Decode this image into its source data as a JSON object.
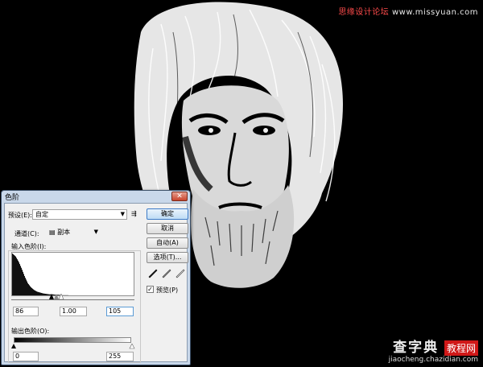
{
  "watermark_top": {
    "cn": "思缘设计论坛",
    "url": "www.missyuan.com"
  },
  "watermark_bottom": {
    "big": "查字典",
    "boxed": "教程网",
    "url": "jiaocheng.chazidian.com"
  },
  "dialog": {
    "title": "色阶",
    "close_symbol": "✕",
    "preset_label": "预设(E):",
    "preset_value": "自定",
    "preset_options_icon": "⇶",
    "channel_label": "通道(C):",
    "channel_value": "副本",
    "input_levels_label": "输入色阶(I):",
    "input_black": "86",
    "input_gamma": "1.00",
    "input_white": "105",
    "output_levels_label": "输出色阶(O):",
    "output_black": "0",
    "output_white": "255",
    "buttons": {
      "ok": "确定",
      "cancel": "取消",
      "auto": "自动(A)",
      "options": "选项(T)..."
    },
    "preview_label": "预览(P)",
    "preview_checked": true,
    "checkmark": "✓",
    "eyedroppers": [
      "black-eyedropper-icon",
      "gray-eyedropper-icon",
      "white-eyedropper-icon"
    ]
  },
  "histogram_profile": [
    98,
    92,
    80,
    64,
    46,
    31,
    22,
    16,
    12,
    10,
    8,
    7,
    6,
    6,
    5,
    5,
    4,
    4,
    4,
    3,
    3,
    3,
    3,
    3,
    3,
    2,
    2,
    2,
    2,
    2,
    2,
    2,
    2,
    2,
    2,
    2,
    2,
    2,
    2,
    2
  ],
  "colors": {
    "dialog_frame": "#c9d8ea",
    "client_bg": "#f0f0f0",
    "close": "#c8432c",
    "accent": "#3d7bc7"
  }
}
